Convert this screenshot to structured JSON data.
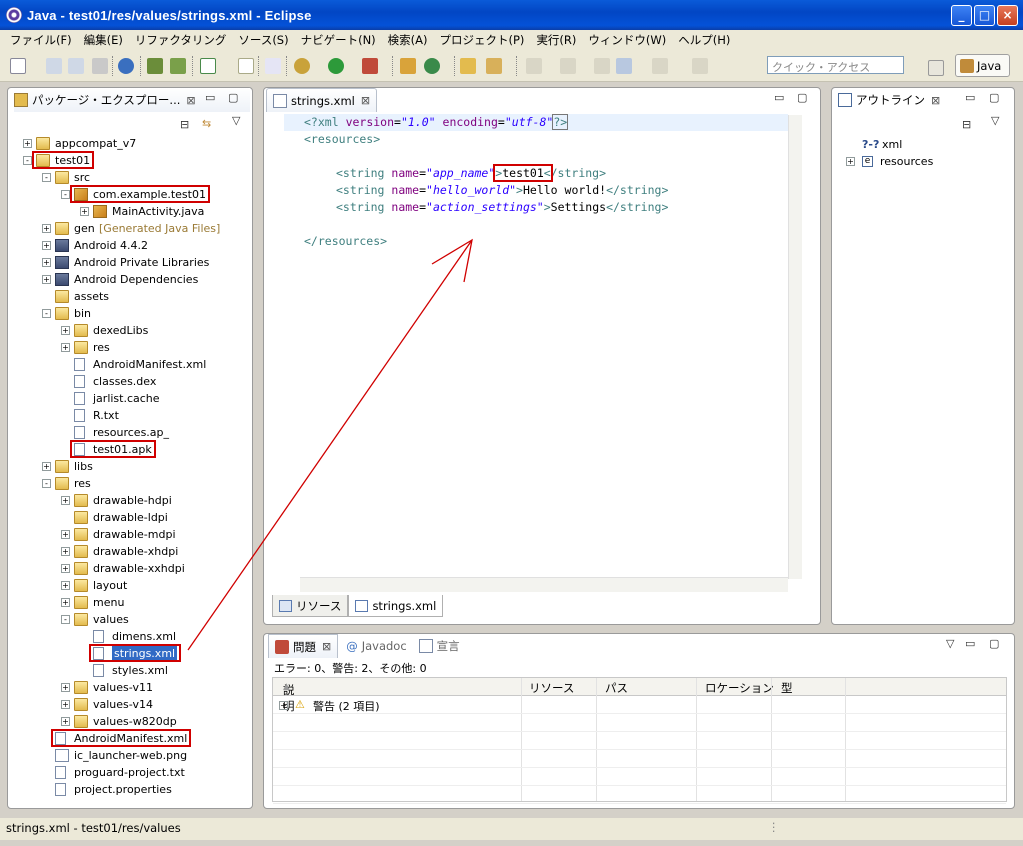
{
  "window": {
    "title": "Java - test01/res/values/strings.xml - Eclipse"
  },
  "menu": [
    "ファイル(F)",
    "編集(E)",
    "リファクタリング",
    "ソース(S)",
    "ナビゲート(N)",
    "検索(A)",
    "プロジェクト(P)",
    "実行(R)",
    "ウィンドウ(W)",
    "ヘルプ(H)"
  ],
  "toolbar": {
    "quick_access_placeholder": "クイック・アクセス",
    "perspective_label": "Java"
  },
  "package_explorer": {
    "title": "パッケージ・エクスプロー...",
    "tree": [
      {
        "label": "appcompat_v7",
        "depth": 0,
        "exp": "+",
        "icon": "project-folder-icon"
      },
      {
        "label": "test01",
        "depth": 0,
        "exp": "-",
        "icon": "project-folder-icon",
        "hl": true
      },
      {
        "label": "src",
        "depth": 1,
        "exp": "-",
        "icon": "source-folder-icon"
      },
      {
        "label": "com.example.test01",
        "depth": 2,
        "exp": "-",
        "icon": "package-icon",
        "hl": true
      },
      {
        "label": "MainActivity.java",
        "depth": 3,
        "exp": "+",
        "icon": "java-file-icon"
      },
      {
        "label": "gen",
        "depth": 1,
        "exp": "+",
        "icon": "source-folder-icon",
        "suffix": "[Generated Java Files]"
      },
      {
        "label": "Android 4.4.2",
        "depth": 1,
        "exp": "+",
        "icon": "library-icon"
      },
      {
        "label": "Android Private Libraries",
        "depth": 1,
        "exp": "+",
        "icon": "library-icon"
      },
      {
        "label": "Android Dependencies",
        "depth": 1,
        "exp": "+",
        "icon": "library-icon"
      },
      {
        "label": "assets",
        "depth": 1,
        "exp": "",
        "icon": "folder-icon"
      },
      {
        "label": "bin",
        "depth": 1,
        "exp": "-",
        "icon": "folder-icon"
      },
      {
        "label": "dexedLibs",
        "depth": 2,
        "exp": "+",
        "icon": "folder-icon"
      },
      {
        "label": "res",
        "depth": 2,
        "exp": "+",
        "icon": "folder-icon"
      },
      {
        "label": "AndroidManifest.xml",
        "depth": 2,
        "exp": "",
        "icon": "xml-file-icon"
      },
      {
        "label": "classes.dex",
        "depth": 2,
        "exp": "",
        "icon": "file-icon"
      },
      {
        "label": "jarlist.cache",
        "depth": 2,
        "exp": "",
        "icon": "file-icon"
      },
      {
        "label": "R.txt",
        "depth": 2,
        "exp": "",
        "icon": "file-icon"
      },
      {
        "label": "resources.ap_",
        "depth": 2,
        "exp": "",
        "icon": "file-icon"
      },
      {
        "label": "test01.apk",
        "depth": 2,
        "exp": "",
        "icon": "file-icon",
        "hl": true
      },
      {
        "label": "libs",
        "depth": 1,
        "exp": "+",
        "icon": "folder-icon"
      },
      {
        "label": "res",
        "depth": 1,
        "exp": "-",
        "icon": "folder-icon"
      },
      {
        "label": "drawable-hdpi",
        "depth": 2,
        "exp": "+",
        "icon": "folder-icon"
      },
      {
        "label": "drawable-ldpi",
        "depth": 2,
        "exp": "",
        "icon": "folder-icon"
      },
      {
        "label": "drawable-mdpi",
        "depth": 2,
        "exp": "+",
        "icon": "folder-icon"
      },
      {
        "label": "drawable-xhdpi",
        "depth": 2,
        "exp": "+",
        "icon": "folder-icon"
      },
      {
        "label": "drawable-xxhdpi",
        "depth": 2,
        "exp": "+",
        "icon": "folder-icon"
      },
      {
        "label": "layout",
        "depth": 2,
        "exp": "+",
        "icon": "folder-icon"
      },
      {
        "label": "menu",
        "depth": 2,
        "exp": "+",
        "icon": "folder-icon"
      },
      {
        "label": "values",
        "depth": 2,
        "exp": "-",
        "icon": "folder-icon"
      },
      {
        "label": "dimens.xml",
        "depth": 3,
        "exp": "",
        "icon": "xml-file-icon"
      },
      {
        "label": "strings.xml",
        "depth": 3,
        "exp": "",
        "icon": "xml-file-icon",
        "hl": true,
        "selected": true
      },
      {
        "label": "styles.xml",
        "depth": 3,
        "exp": "",
        "icon": "xml-file-icon"
      },
      {
        "label": "values-v11",
        "depth": 2,
        "exp": "+",
        "icon": "folder-icon"
      },
      {
        "label": "values-v14",
        "depth": 2,
        "exp": "+",
        "icon": "folder-icon"
      },
      {
        "label": "values-w820dp",
        "depth": 2,
        "exp": "+",
        "icon": "folder-icon"
      },
      {
        "label": "AndroidManifest.xml",
        "depth": 1,
        "exp": "",
        "icon": "xml-file-icon",
        "hl": true
      },
      {
        "label": "ic_launcher-web.png",
        "depth": 1,
        "exp": "",
        "icon": "image-file-icon"
      },
      {
        "label": "proguard-project.txt",
        "depth": 1,
        "exp": "",
        "icon": "file-icon"
      },
      {
        "label": "project.properties",
        "depth": 1,
        "exp": "",
        "icon": "file-icon"
      }
    ]
  },
  "editor": {
    "tab": "strings.xml",
    "bottom_tabs": [
      "リソース",
      "strings.xml"
    ],
    "code": {
      "l1": {
        "a": "<?",
        "b": "xml",
        "c": " version",
        "d": "=",
        "e": "\"1.0\"",
        "f": " encoding",
        "g": "=",
        "h": "\"utf-8\"",
        "i": "?>"
      },
      "l2": "<resources>",
      "l4": {
        "open": "<string",
        "attr": " name",
        "eq": "=",
        "val": "\"app_name\"",
        "gt": ">",
        "text": "test01",
        "close": "</string>"
      },
      "l5": {
        "open": "<string",
        "attr": " name",
        "eq": "=",
        "val": "\"hello_world\"",
        "gt": ">",
        "text": "Hello world!",
        "close": "</string>"
      },
      "l6": {
        "open": "<string",
        "attr": " name",
        "eq": "=",
        "val": "\"action_settings\"",
        "gt": ">",
        "text": "Settings",
        "close": "</string>"
      },
      "l8": "</resources>"
    }
  },
  "outline": {
    "title": "アウトライン",
    "items": [
      {
        "label": "xml",
        "prefix": "?-?"
      },
      {
        "label": "resources",
        "prefix": "e"
      }
    ]
  },
  "problems": {
    "tabs": [
      "問題",
      "Javadoc",
      "宣言"
    ],
    "summary": "エラー: 0、警告: 2、その他: 0",
    "columns": [
      "説明",
      "リソース",
      "パス",
      "ロケーション",
      "型"
    ],
    "rows": [
      {
        "desc": "警告 (2 項目)"
      }
    ]
  },
  "status": {
    "text": "strings.xml - test01/res/values"
  },
  "colors": {
    "accent": "#316ac5",
    "annotation_red": "#d00000"
  }
}
